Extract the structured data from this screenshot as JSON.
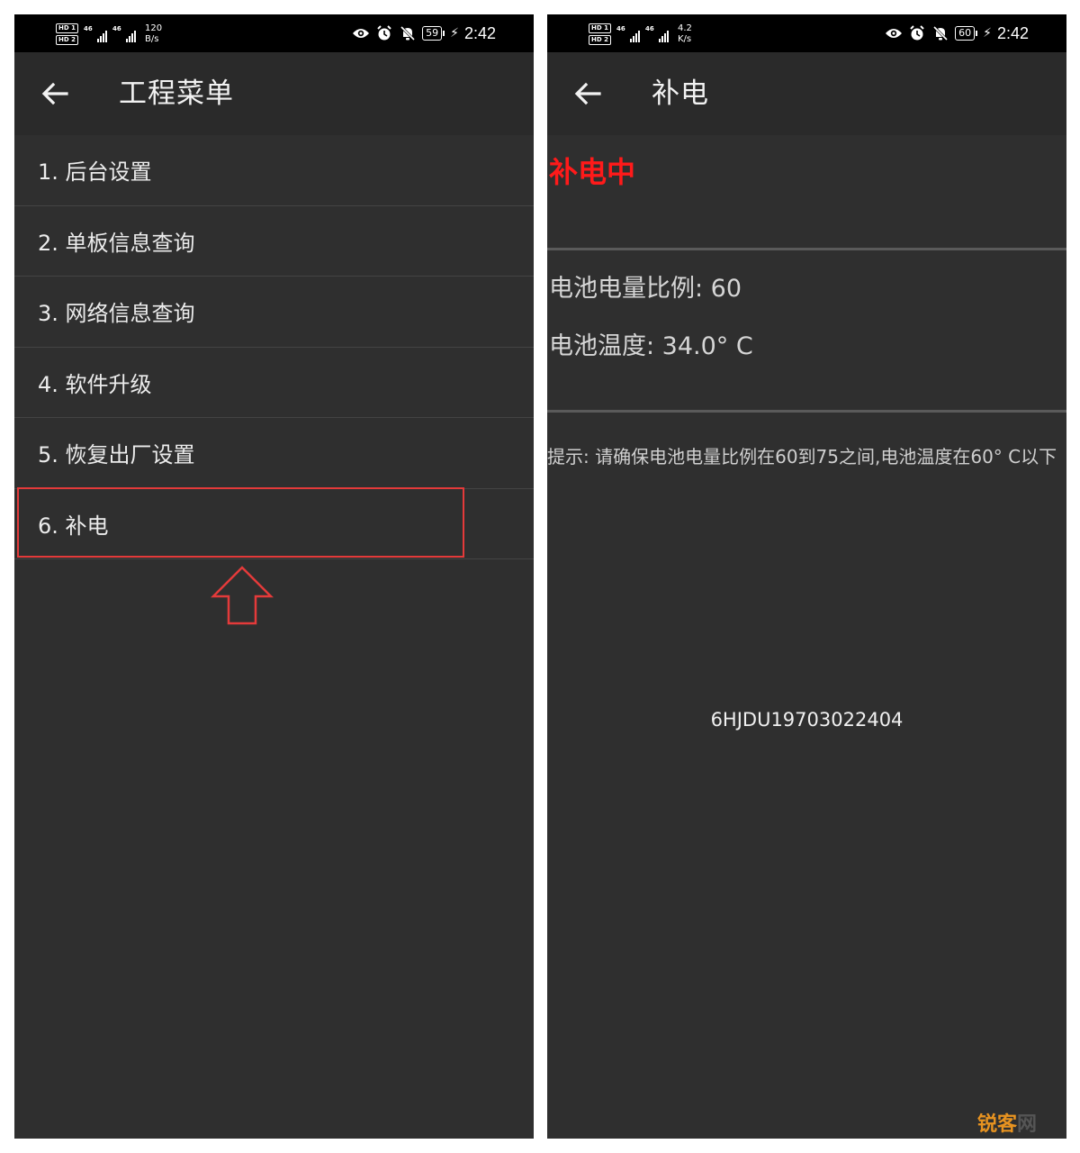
{
  "left": {
    "status": {
      "hd1": "HD 1",
      "hd2": "HD 2",
      "sig1": "46",
      "sig2": "46",
      "speed_value": "120",
      "speed_unit": "B/s",
      "battery": "59",
      "time": "2:42"
    },
    "title": "工程菜单",
    "menu": [
      {
        "label": "1. 后台设置"
      },
      {
        "label": "2. 单板信息查询"
      },
      {
        "label": "3. 网络信息查询"
      },
      {
        "label": "4. 软件升级"
      },
      {
        "label": "5. 恢复出厂设置"
      },
      {
        "label": "6. 补电"
      }
    ],
    "highlight_color": "#e43a3a"
  },
  "right": {
    "status": {
      "hd1": "HD 1",
      "hd2": "HD 2",
      "sig1": "46",
      "sig2": "46",
      "speed_value": "4.2",
      "speed_unit": "K/s",
      "battery": "60",
      "time": "2:42"
    },
    "title": "补电",
    "charging_status": "补电中",
    "charging_color": "#ff1a1a",
    "battery_level": "电池电量比例:  60",
    "battery_temp": "电池温度:   34.0° C",
    "hint": "提示: 请确保电池电量比例在60到75之间,电池温度在60° C以下",
    "serial": "6HJDU19703022404"
  },
  "watermark": {
    "part1": "锐客",
    "part2": "网"
  }
}
